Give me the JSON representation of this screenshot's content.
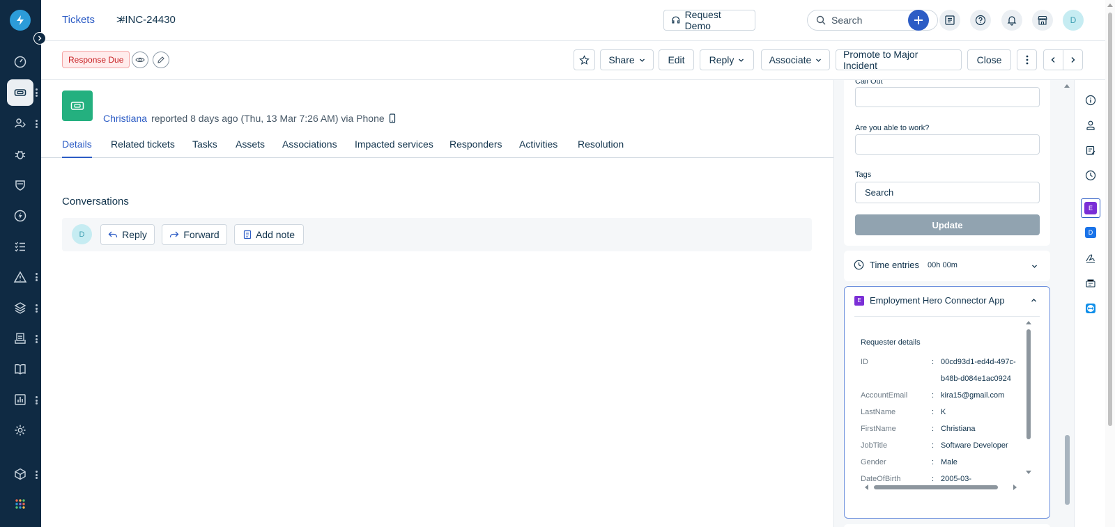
{
  "breadcrumb": {
    "root": "Tickets",
    "separator": ">",
    "current": "#INC-24430"
  },
  "header": {
    "request_demo": "Request Demo",
    "search_placeholder": "Search",
    "avatar_initial": "D"
  },
  "toolbar": {
    "status_badge": "Response Due",
    "share": "Share",
    "edit": "Edit",
    "reply": "Reply",
    "associate": "Associate",
    "promote": "Promote to Major Incident",
    "close": "Close"
  },
  "ticket": {
    "requester": "Christiana",
    "reported_text": "reported 8 days ago (Thu, 13 Mar 7:26 AM) via Phone"
  },
  "tabs": [
    {
      "label": "Details",
      "active": true
    },
    {
      "label": "Related tickets"
    },
    {
      "label": "Tasks"
    },
    {
      "label": "Assets"
    },
    {
      "label": "Associations"
    },
    {
      "label": "Impacted services"
    },
    {
      "label": "Responders"
    },
    {
      "label": "Activities"
    },
    {
      "label": "Resolution"
    }
  ],
  "conversations": {
    "title": "Conversations",
    "avatar_initial": "D",
    "reply": "Reply",
    "forward": "Forward",
    "add_note": "Add note"
  },
  "properties": {
    "call_out_label": "Call Out",
    "able_to_work_label": "Are you able to work?",
    "tags_label": "Tags",
    "tags_placeholder": "Search",
    "update": "Update"
  },
  "time_entries": {
    "label": "Time entries",
    "value": "00h 00m"
  },
  "connector": {
    "icon_letter": "E",
    "title": "Employment Hero Connector App",
    "section": "Requester details",
    "rows": [
      {
        "label": "ID",
        "value": "00cd93d1-ed4d-497c-",
        "value2": "b48b-d084e1ac0924"
      },
      {
        "label": "AccountEmail",
        "value": "kira15@gmail.com"
      },
      {
        "label": "LastName",
        "value": "K"
      },
      {
        "label": "FirstName",
        "value": "Christiana"
      },
      {
        "label": "JobTitle",
        "value": "Software Developer"
      },
      {
        "label": "Gender",
        "value": "Male"
      },
      {
        "label": "DateOfBirth",
        "value": "2005-03-"
      }
    ]
  },
  "strip": {
    "e_letter": "E",
    "d_letter": "D"
  },
  "colors": {
    "nav_bg": "#0f2a43",
    "link": "#2c5cc5",
    "ticket_icon": "#24b07f",
    "due_badge": "#c82124",
    "connector_purple": "#7b2fd6"
  }
}
